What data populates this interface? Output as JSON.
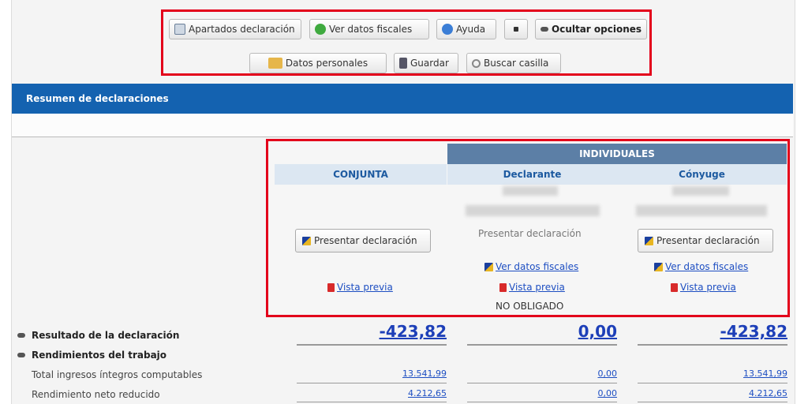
{
  "toolbar": {
    "row1": [
      {
        "label": "Apartados declaración",
        "icon": "document-icon"
      },
      {
        "label": "Ver datos fiscales",
        "icon": "check-icon"
      },
      {
        "label": "Ayuda",
        "icon": "help-icon"
      },
      {
        "label": "",
        "icon": "dot-icon"
      },
      {
        "label": "Ocultar opciones",
        "icon": "collapse-icon"
      }
    ],
    "row2": [
      {
        "label": "Datos personales",
        "icon": "people-icon"
      },
      {
        "label": "Guardar",
        "icon": "save-icon"
      },
      {
        "label": "Buscar casilla",
        "icon": "search-icon"
      }
    ]
  },
  "section_title": "Resumen de declaraciones",
  "columns": {
    "individuales": "INDIVIDUALES",
    "conjunta": "CONJUNTA",
    "declarante": "Declarante",
    "conyuge": "Cónyuge"
  },
  "actions": {
    "presentar": "Presentar declaración",
    "ver_datos": "Ver datos fiscales",
    "vista_previa": "Vista previa",
    "no_obligado": "NO OBLIGADO"
  },
  "rows": {
    "resultado": {
      "label": "Resultado de la declaración",
      "conjunta": "-423,82",
      "declarante": "0,00",
      "conyuge": "-423,82"
    },
    "rendimientos": {
      "label": "Rendimientos del trabajo"
    },
    "total_ingresos": {
      "label": "Total ingresos íntegros computables",
      "conjunta": "13.541,99",
      "declarante": "0,00",
      "conyuge": "13.541,99"
    },
    "rendimiento_neto": {
      "label": "Rendimiento neto reducido",
      "conjunta": "4.212,65",
      "declarante": "0,00",
      "conyuge": "4.212,65"
    }
  },
  "colors": {
    "accent": "#1462b0",
    "highlight": "#e3001b",
    "link": "#1d4ec2"
  }
}
